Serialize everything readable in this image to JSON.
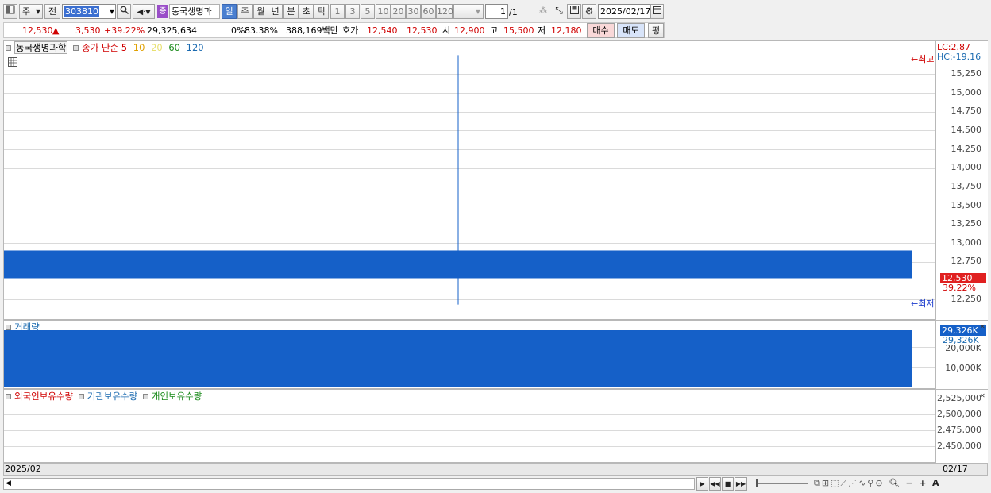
{
  "toolbar": {
    "period_type": "주",
    "compare_label": "전",
    "code": "303810",
    "stock_name": "동국생명과",
    "stock_badge": "종",
    "periods": [
      "일",
      "주",
      "월",
      "년",
      "분",
      "초",
      "틱"
    ],
    "active_period": "일",
    "intervals": [
      "1",
      "3",
      "5",
      "10",
      "20",
      "30",
      "60",
      "120"
    ],
    "page_value": "1",
    "page_total": "/1",
    "date": "2025/02/17"
  },
  "quote": {
    "price": "12,530",
    "arrow": "▲",
    "change": "3,530",
    "change_pct": "+39.22%",
    "volume": "29,325,634",
    "zero_pct": "0%",
    "ratio": "83.38%",
    "amount": "388,169백만",
    "bid_label": "호가",
    "bid1": "12,540",
    "bid2": "12,530",
    "open_label": "시",
    "open": "12,900",
    "high_label": "고",
    "high": "15,500",
    "low_label": "저",
    "low": "12,180",
    "buy_label": "매수",
    "sell_label": "매도",
    "avg_label": "평"
  },
  "price_panel": {
    "name_tag": "동국생명과학",
    "indicator": "종가 단순",
    "ma": [
      {
        "label": "5",
        "color": "#d00000"
      },
      {
        "label": "10",
        "color": "#e0a000"
      },
      {
        "label": "20",
        "color": "#e8e070"
      },
      {
        "label": "60",
        "color": "#1a8a1a"
      },
      {
        "label": "120",
        "color": "#1a6ab0"
      }
    ],
    "lc": "LC:2.87",
    "hc": "HC:-19.16",
    "max_marker": "←최고",
    "min_marker": "←최저",
    "ticks": [
      "15,250",
      "15,000",
      "14,750",
      "14,500",
      "14,250",
      "14,000",
      "13,750",
      "13,500",
      "13,250",
      "13,000",
      "12,750",
      "12,250"
    ],
    "current_price_tag": "12,530",
    "current_pct_tag": "39.22%",
    "candle": {
      "open": 12900,
      "high": 15500,
      "low": 12180,
      "close": 12530
    }
  },
  "volume_panel": {
    "title": "거래량",
    "ticks": [
      "20,000K",
      "10,000K"
    ],
    "current_tag": "29,326K",
    "current_tag2": "29,326K",
    "volume_k": 29326
  },
  "holdings_panel": {
    "legend": [
      {
        "label": "외국인보유수량",
        "color": "#d00000"
      },
      {
        "label": "기관보유수량",
        "color": "#1a6ab0"
      },
      {
        "label": "개인보유수량",
        "color": "#1a8a1a"
      }
    ],
    "ticks": [
      "2,525,000",
      "2,500,000",
      "2,475,000",
      "2,450,000"
    ]
  },
  "footer": {
    "left_date": "2025/02",
    "right_date": "02/17"
  },
  "colors": {
    "bar_blue": "#1560c8",
    "down_red": "#e02020"
  }
}
